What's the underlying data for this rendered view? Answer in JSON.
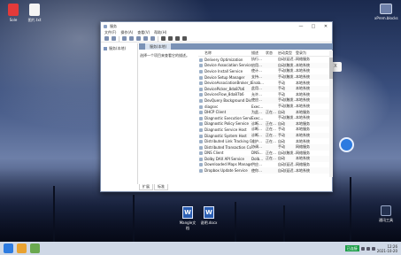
{
  "desktop": {
    "icons": [
      {
        "label": "Sole",
        "icon": "app-icon"
      },
      {
        "label": "图片.txt",
        "icon": "document-icon"
      }
    ],
    "right_top": {
      "label": "xPrem.blocks",
      "icon": "app-icon"
    },
    "word_files": [
      {
        "label": "Mangle文档",
        "icon": "word-icon",
        "letter": "W"
      },
      {
        "label": "说明.docx",
        "icon": "word-icon",
        "letter": "W"
      }
    ],
    "right_bottom": {
      "label": "通讯工具",
      "icon": "app-icon"
    },
    "bubble": "",
    "side_chip": "X"
  },
  "window": {
    "title": "服务",
    "controls": [
      "—",
      "□",
      "✕"
    ],
    "menu": [
      "文件(F)",
      "操作(A)",
      "查看(V)",
      "帮助(H)"
    ],
    "tree_node": "服务(本地)",
    "header_tab": "服务(本地)",
    "description": "选择一个项目来查看它的描述。",
    "columns": [
      "名称",
      "描述",
      "状态",
      "启动类型",
      "登录为"
    ],
    "rows": [
      [
        "Delivery Optimization",
        "执行…",
        "",
        "自动(延迟…",
        "网络服务"
      ],
      [
        "Device Association Service",
        "启用…",
        "",
        "自动(触发…",
        "本地系统"
      ],
      [
        "Device Install Service",
        "使计…",
        "",
        "手动(触发…",
        "本地系统"
      ],
      [
        "Device Setup Manager",
        "支持…",
        "",
        "手动(触发…",
        "本地系统"
      ],
      [
        "DeviceAssociationBroker_b…",
        "Enab…",
        "",
        "手动",
        "本地系统"
      ],
      [
        "DevicePicker_8da87b6",
        "此用…",
        "",
        "手动",
        "本地系统"
      ],
      [
        "DevicesFlow_8da87b6",
        "允许…",
        "",
        "手动",
        "本地系统"
      ],
      [
        "DevQuery Background Dis…",
        "使应…",
        "",
        "手动(触发…",
        "本地系统"
      ],
      [
        "diagsvc",
        "Exec…",
        "",
        "手动(触发…",
        "本地系统"
      ],
      [
        "DHCP Client",
        "为此…",
        "正在…",
        "自动",
        "本地服务"
      ],
      [
        "Diagnostic Execution Service",
        "Exec…",
        "",
        "手动(触发…",
        "本地系统"
      ],
      [
        "Diagnostic Policy Service",
        "诊断…",
        "正在…",
        "自动",
        "本地服务"
      ],
      [
        "Diagnostic Service Host",
        "诊断…",
        "正在…",
        "手动",
        "本地服务"
      ],
      [
        "Diagnostic System Host",
        "诊断…",
        "正在…",
        "手动",
        "本地系统"
      ],
      [
        "Distributed Link Tracking C…",
        "维护…",
        "正在…",
        "自动",
        "本地系统"
      ],
      [
        "Distributed Transaction Co…",
        "协调…",
        "",
        "手动",
        "网络服务"
      ],
      [
        "DNS Client",
        "DNS…",
        "正在…",
        "自动(触发…",
        "网络服务"
      ],
      [
        "Dolby DAX API Service",
        "Dolb…",
        "正在…",
        "自动",
        "本地系统"
      ],
      [
        "Downloaded Maps Manager",
        "供应…",
        "",
        "自动(延迟…",
        "网络服务"
      ],
      [
        "Dropbox Update Service",
        "使你…",
        "",
        "自动(延迟…",
        "本地系统"
      ]
    ],
    "bottom_tabs": [
      "扩展",
      "标准"
    ]
  },
  "taskbar": {
    "notification": "已连接",
    "clock_time": "12:26",
    "clock_date": "2021-10-20"
  }
}
